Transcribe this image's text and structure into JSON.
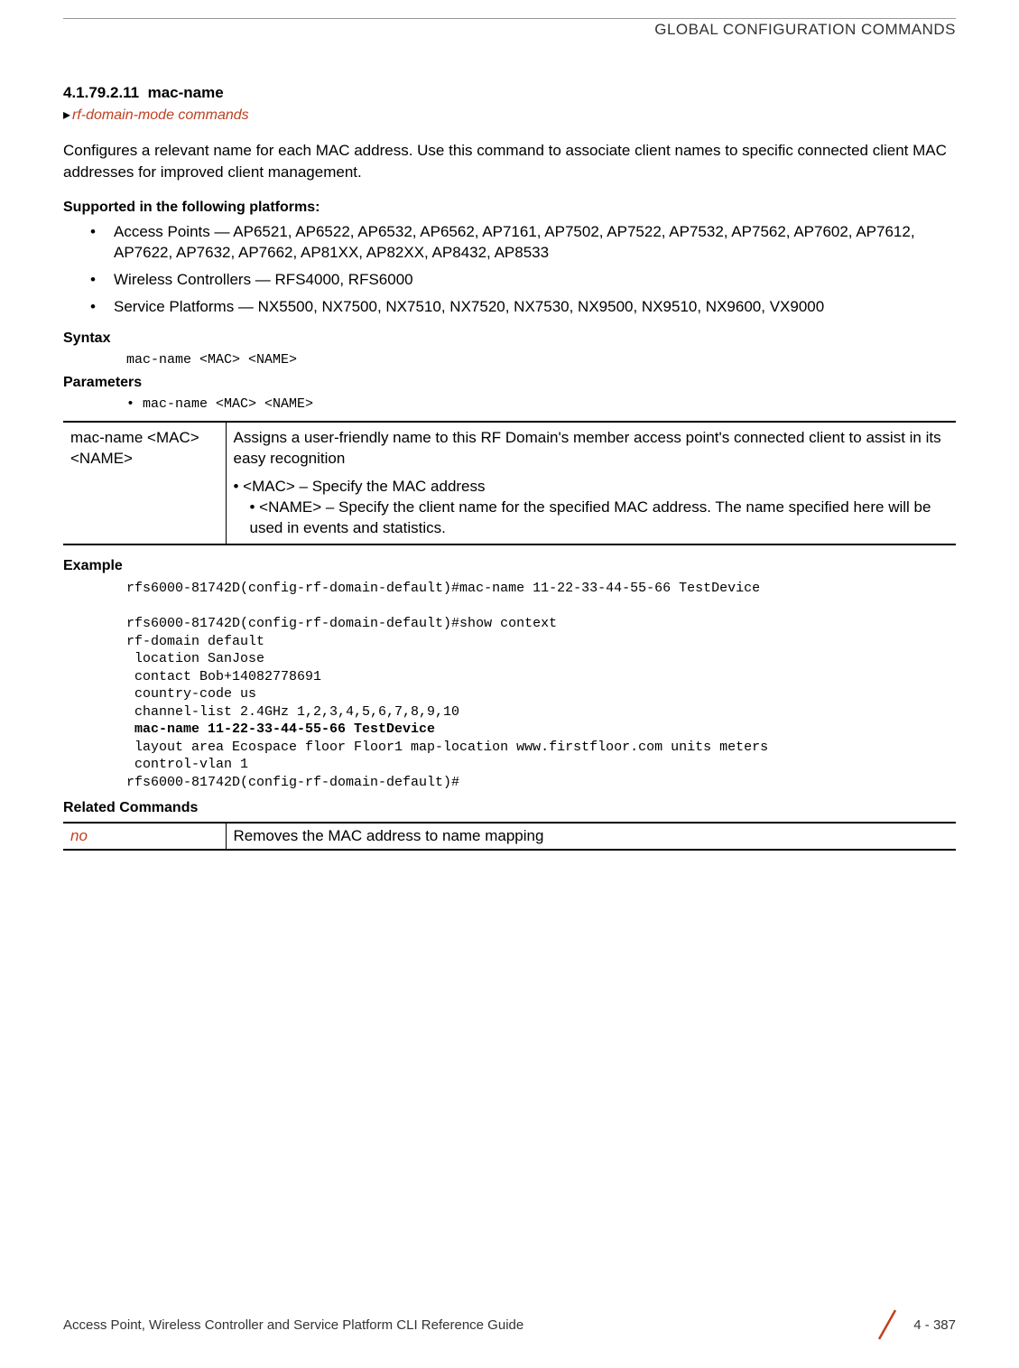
{
  "header": "GLOBAL CONFIGURATION COMMANDS",
  "section": {
    "number": "4.1.79.2.11",
    "title": "mac-name"
  },
  "breadcrumb": "rf-domain-mode commands",
  "intro": "Configures a relevant name for each MAC address. Use this command to associate client names to specific connected client MAC addresses for improved client management.",
  "supported_heading": "Supported in the following platforms:",
  "platforms": [
    "Access Points — AP6521, AP6522, AP6532, AP6562, AP7161, AP7502, AP7522, AP7532, AP7562, AP7602, AP7612, AP7622, AP7632, AP7662, AP81XX, AP82XX, AP8432, AP8533",
    "Wireless Controllers — RFS4000, RFS6000",
    "Service Platforms — NX5500, NX7500, NX7510, NX7520, NX7530, NX9500, NX9510, NX9600, VX9000"
  ],
  "syntax_heading": "Syntax",
  "syntax_code": "mac-name <MAC> <NAME>",
  "parameters_heading": "Parameters",
  "parameters_bullet": "• mac-name <MAC> <NAME>",
  "param_table": {
    "col1": "mac-name <MAC> <NAME>",
    "desc": "Assigns a user-friendly name to this RF Domain's member access point's connected client to assist in its easy recognition",
    "bullet1": "•  <MAC> – Specify the MAC address",
    "bullet2": "•  <NAME> – Specify the client name for the specified MAC address. The name specified here will be used in events and statistics."
  },
  "example_heading": "Example",
  "example": {
    "line1": "rfs6000-81742D(config-rf-domain-default)#mac-name 11-22-33-44-55-66 TestDevice",
    "line2": "",
    "line3": "rfs6000-81742D(config-rf-domain-default)#show context",
    "line4": "rf-domain default",
    "line5": " location SanJose",
    "line6": " contact Bob+14082778691",
    "line7": " country-code us",
    "line8": " channel-list 2.4GHz 1,2,3,4,5,6,7,8,9,10",
    "line9": " mac-name 11-22-33-44-55-66 TestDevice",
    "line10": " layout area Ecospace floor Floor1 map-location www.firstfloor.com units meters",
    "line11": " control-vlan 1",
    "line12": "rfs6000-81742D(config-rf-domain-default)#"
  },
  "related_heading": "Related Commands",
  "related_table": {
    "col1": "no",
    "col2": "Removes the MAC address to name mapping"
  },
  "footer": {
    "left": "Access Point, Wireless Controller and Service Platform CLI Reference Guide",
    "page": "4 - 387"
  }
}
